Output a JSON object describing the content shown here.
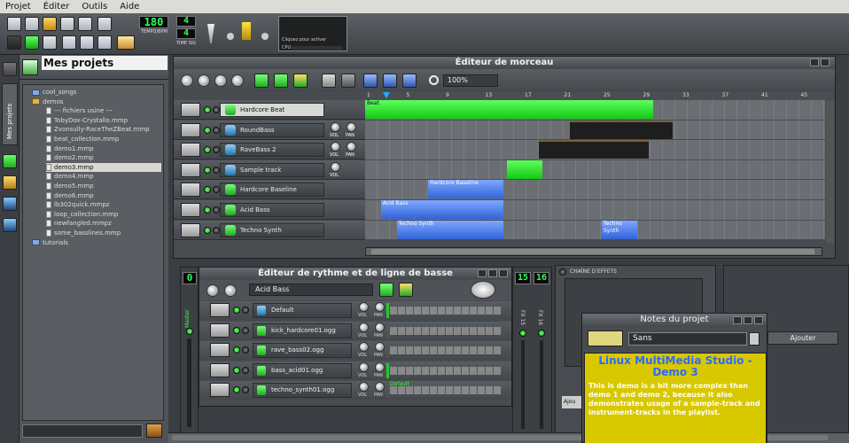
{
  "menu": {
    "projet": "Projet",
    "editer": "Éditer",
    "outils": "Outils",
    "aide": "Aide"
  },
  "toolbar": {
    "tempo": "180",
    "tempo_label": "TEMPO/BPM",
    "ts_num": "4",
    "ts_den": "4",
    "ts_label": "TIME SIG",
    "cpu_label": "Cliquez pour activer",
    "cpu_short": "CPU"
  },
  "sidebar": {
    "title": "Mes projets",
    "vertical_label": "Mes projets",
    "items": [
      {
        "label": "cool_songs",
        "type": "folder"
      },
      {
        "label": "demos",
        "type": "folder-open"
      },
      {
        "label": "--- fichiers usine ---",
        "type": "file"
      },
      {
        "label": "TobyDox-Crystallo.mmp",
        "type": "file"
      },
      {
        "label": "Zvonsully-RaceTheZBeat.mmp",
        "type": "file"
      },
      {
        "label": "beat_collection.mmp",
        "type": "file"
      },
      {
        "label": "demo1.mmp",
        "type": "file"
      },
      {
        "label": "demo2.mmp",
        "type": "file"
      },
      {
        "label": "demo3.mmp",
        "type": "file",
        "selected": true
      },
      {
        "label": "demo4.mmp",
        "type": "file"
      },
      {
        "label": "demo5.mmp",
        "type": "file"
      },
      {
        "label": "demo6.mmp",
        "type": "file"
      },
      {
        "label": "lb302quick.mmpz",
        "type": "file"
      },
      {
        "label": "loop_collection.mmp",
        "type": "file"
      },
      {
        "label": "newfangled.mmpz",
        "type": "file"
      },
      {
        "label": "some_basslines.mmp",
        "type": "file"
      },
      {
        "label": "tutorials",
        "type": "folder"
      }
    ]
  },
  "song_editor": {
    "title": "Éditeur de morceau",
    "zoom": "100%",
    "timeline": [
      "1",
      "5",
      "9",
      "13",
      "17",
      "21",
      "25",
      "29",
      "33",
      "37",
      "41",
      "45"
    ],
    "tracks": [
      {
        "name": "Hardcore Beat",
        "has_vol": false,
        "highlighted": true
      },
      {
        "name": "RoundBass",
        "has_vol": true
      },
      {
        "name": "RaveBass 2",
        "has_vol": true
      },
      {
        "name": "Sample track",
        "has_vol": true,
        "vol_only": true
      },
      {
        "name": "Hardcore Baseline",
        "has_vol": false
      },
      {
        "name": "Acid Bass",
        "has_vol": false
      },
      {
        "name": "Techno Synth",
        "has_vol": false
      }
    ],
    "clips": [
      {
        "track": 0,
        "start": 0,
        "len": 7.3,
        "label": "Beat",
        "color": "green"
      },
      {
        "track": 1,
        "start": 5.2,
        "len": 2.6,
        "label": "",
        "color": "dark"
      },
      {
        "track": 2,
        "start": 4.4,
        "len": 2.8,
        "label": "",
        "color": "dark"
      },
      {
        "track": 3,
        "start": 3.6,
        "len": 0.9,
        "label": "",
        "color": "green"
      },
      {
        "track": 4,
        "start": 1.6,
        "len": 1.9,
        "label": "Hardcore Baseline",
        "color": "blue"
      },
      {
        "track": 5,
        "start": 0.4,
        "len": 3.1,
        "label": "Acid Bass",
        "color": "blue"
      },
      {
        "track": 6,
        "start": 0.8,
        "len": 2.7,
        "label": "Techno Synth",
        "color": "blue"
      },
      {
        "track": 6,
        "start": 6.0,
        "len": 0.9,
        "label": "Techno Synth",
        "color": "blue"
      }
    ]
  },
  "bb_editor": {
    "title": "Éditeur de rythme et de ligne de basse",
    "selected": "Acid Bass",
    "master_label": "Master",
    "fx15": "FX 15",
    "fx16": "FX 16",
    "lcd0": "0",
    "lcd15": "15",
    "lcd16": "16",
    "tracks": [
      {
        "name": "Default",
        "instrument": true
      },
      {
        "name": "kick_hardcore01.ogg"
      },
      {
        "name": "rave_bass02.ogg"
      },
      {
        "name": "bass_acid01.ogg"
      },
      {
        "name": "techno_synth01.ogg",
        "default_label": "Default"
      }
    ]
  },
  "fx_chain": {
    "title": "CHAÎNE D'EFFETS"
  },
  "notes": {
    "title": "Notes du projet",
    "font": "Sans",
    "add_label": "Ajouter",
    "side_label": "Ajou",
    "heading": "Linux MultiMedia Studio - Demo 3",
    "body": "This is demo is a bit more complex than demo 1 and demo 2, because it also demonstrates usage of a sample-track and instrument-tracks in the playlist."
  },
  "labels": {
    "vol": "VOL",
    "pan": "PAN"
  }
}
